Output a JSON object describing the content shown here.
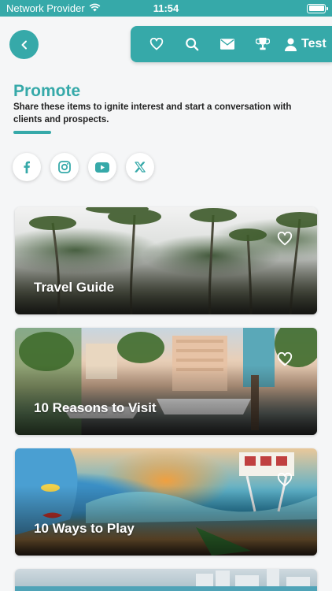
{
  "status": {
    "carrier": "Network Provider",
    "time": "11:54"
  },
  "nav": {
    "user_label": "Test",
    "icons": [
      "heart-icon",
      "search-icon",
      "mail-icon",
      "trophy-icon",
      "user-icon"
    ]
  },
  "header": {
    "title": "Promote",
    "description": "Share these items to ignite interest and start a conversation with clients and prospects."
  },
  "socials": [
    "facebook-icon",
    "instagram-icon",
    "youtube-icon",
    "x-icon"
  ],
  "cards": [
    {
      "title": "Travel Guide"
    },
    {
      "title": "10 Reasons to Visit"
    },
    {
      "title": "10 Ways to Play"
    },
    {
      "title": ""
    }
  ],
  "colors": {
    "accent": "#36a9a9",
    "background": "#f5f6f7"
  }
}
